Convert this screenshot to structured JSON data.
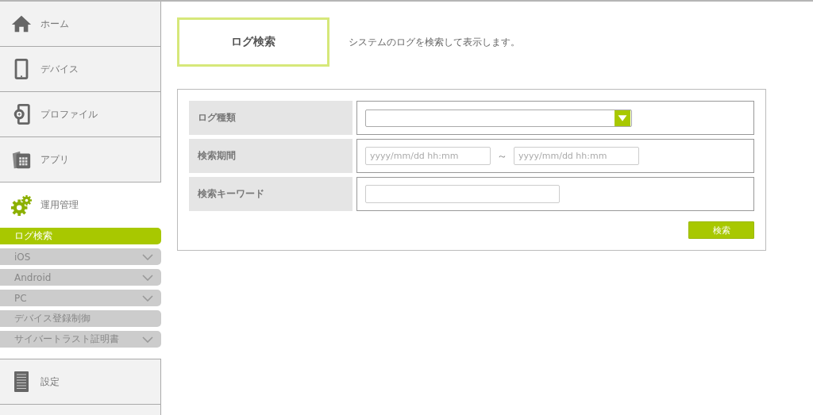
{
  "sidebar": {
    "items": [
      {
        "label": "ホーム",
        "kind": "home",
        "expanded": false
      },
      {
        "label": "デバイス",
        "kind": "device",
        "expanded": false
      },
      {
        "label": "プロファイル",
        "kind": "profile",
        "expanded": false
      },
      {
        "label": "アプリ",
        "kind": "app",
        "expanded": false
      },
      {
        "label": "運用管理",
        "kind": "gears",
        "expanded": true,
        "children": [
          {
            "label": "ログ検索",
            "selected": true,
            "has_submenu": false
          },
          {
            "label": "iOS",
            "selected": false,
            "has_submenu": true
          },
          {
            "label": "Android",
            "selected": false,
            "has_submenu": true
          },
          {
            "label": "PC",
            "selected": false,
            "has_submenu": true
          },
          {
            "label": "デバイス登録制御",
            "selected": false,
            "has_submenu": false
          },
          {
            "label": "サイバートラスト証明書",
            "selected": false,
            "has_submenu": true
          }
        ]
      },
      {
        "label": "設定",
        "kind": "document",
        "expanded": false
      }
    ]
  },
  "header": {
    "title": "ログ検索",
    "description": "システムのログを検索して表示します。"
  },
  "form": {
    "rows": [
      {
        "label": "ログ種類",
        "kind": "select"
      },
      {
        "label": "検索期間",
        "kind": "date_range",
        "from_placeholder": "yyyy/mm/dd hh:mm",
        "separator": "～",
        "to_placeholder": "yyyy/mm/dd hh:mm"
      },
      {
        "label": "検索キーワード",
        "kind": "text"
      }
    ],
    "submit": "検索"
  }
}
